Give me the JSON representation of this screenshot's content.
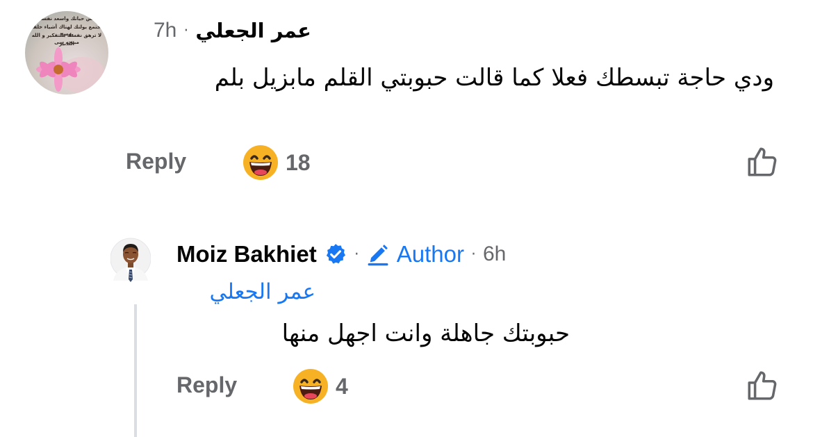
{
  "comment": {
    "author_name": "عمر الجعلي",
    "time": "7h",
    "separator": "·",
    "text": "ودي حاجة تبسطك فعلا كما قالت حبوبتي القلم مابزيل بلم",
    "avatar_caption_lines": [
      "عش حياتك واسعد نفسك",
      "مجتمع يولتك لهتاك أشياء خلقنا بهسح",
      "لا ترهق نفسك بالتفكير و الله مبيحه سى",
      "التدبير"
    ],
    "reply_label": "Reply",
    "reaction_icon": "laughing-emoji-icon",
    "reaction_count": "18",
    "like_icon": "thumbs-up-icon"
  },
  "reply": {
    "author_name": "Moiz Bakhiet",
    "verified_icon": "verified-badge-icon",
    "separator": "·",
    "author_badge_label": "Author",
    "time": "6h",
    "mention": "عمر الجعلي",
    "text": "حبوبتك جاهلة وانت اجهل منها",
    "reply_label": "Reply",
    "reaction_icon": "laughing-emoji-icon",
    "reaction_count": "4",
    "like_icon": "thumbs-up-icon"
  },
  "colors": {
    "text_primary": "#050505",
    "text_secondary": "#65676b",
    "accent_blue": "#1877f2",
    "thread_line": "#dadde1",
    "emoji_yellow": "#f7b125"
  }
}
